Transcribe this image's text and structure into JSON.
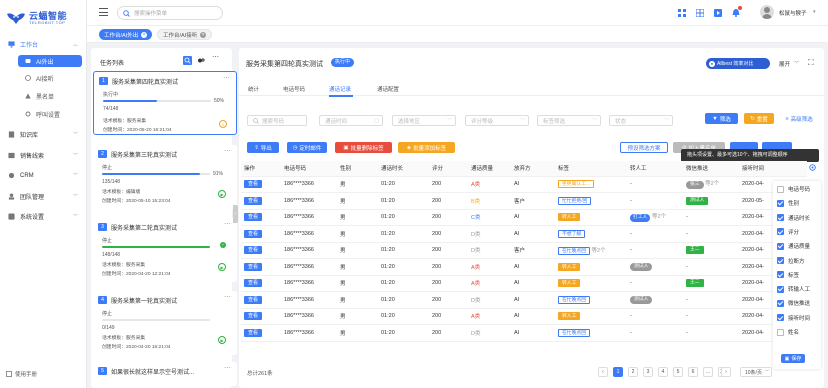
{
  "brand": {
    "name": "云蝠智能",
    "sub": "TELROBOT.TOP"
  },
  "sidebar": {
    "items": [
      {
        "label": "工作台",
        "icon": "monitor-icon"
      },
      {
        "label": "AI外出"
      },
      {
        "label": "AI接听"
      },
      {
        "label": "黑名单"
      },
      {
        "label": "呼叫设置"
      },
      {
        "label": "知识库"
      },
      {
        "label": "销售线索"
      },
      {
        "label": "CRM"
      },
      {
        "label": "团队管理"
      },
      {
        "label": "系统设置"
      }
    ],
    "manual": "使用手册"
  },
  "header": {
    "search_placeholder": "搜索操作菜单",
    "user": "松鼠与猴子"
  },
  "tabs": [
    {
      "label": "工作台/AI外出"
    },
    {
      "label": "工作台/AI接听"
    }
  ],
  "tasks": {
    "title": "任务列表",
    "items": [
      {
        "num": "1",
        "title": "服务采集第四轮真实测试",
        "status": "执行中",
        "progress": 50,
        "pct": "50%",
        "count": "74/148",
        "template": "话术模板：服务采集",
        "created": "创建时间：2020-05-20 16:21:04"
      },
      {
        "num": "2",
        "title": "服务采集第三轮真实测试",
        "status": "停止",
        "progress": 91,
        "pct": "91%",
        "count": "135/148",
        "template": "话术模板：编辑版",
        "created": "创建时间：2020-05-10 15:23:04"
      },
      {
        "num": "3",
        "title": "服务采集第二轮真实测试",
        "status": "停止",
        "progress": 100,
        "pct": "",
        "count": "148/148",
        "template": "话术模板：服务采集",
        "created": "创建时间：2020-04-20 12:21:04"
      },
      {
        "num": "4",
        "title": "服务采集第一轮真实测试",
        "status": "停止",
        "progress": 0,
        "pct": "",
        "count": "0/149",
        "template": "话术模板：服务采集",
        "created": "创建时间：2020-04-20 16:21:04"
      },
      {
        "num": "5",
        "title": "如果很长就这样显示空号测试..."
      }
    ]
  },
  "main": {
    "title": "服务采集第四轮真实测试",
    "status_badge": "执行中",
    "promo": "Allbest 效率对比",
    "expand": "展开",
    "subtabs": [
      "统计",
      "电话号码",
      "通话记录",
      "通话配置"
    ],
    "filters": [
      "搜索号码",
      "通话时间",
      "选择地区",
      "评分等级",
      "标签筛选",
      "意向",
      "状态"
    ],
    "filter_btn": "筛选",
    "reset_btn": "重置",
    "adv_btn": "高级筛选",
    "actions": [
      "导出",
      "定时邮件",
      "批量删除标签",
      "批量添加标签"
    ],
    "right_actions": [
      "预设筛选方案",
      "加入黑名单"
    ],
    "tooltip": "拖头项设置、最多可选10个、拖拽可调整顺序",
    "columns": [
      "操作",
      "电话号码",
      "性别",
      "通话时长",
      "评分",
      "通话质量",
      "放弃方",
      "标签",
      "转人工",
      "微信推送",
      "接听时间"
    ],
    "rows": [
      {
        "op": "查看",
        "phone": "186****3366",
        "sex": "男",
        "dur": "01:20",
        "score": "200",
        "q": "A类",
        "qc": "#e74c3c",
        "who": "AI",
        "tag": "拒绝确认工...",
        "tagc": "#f5a623",
        "tagbg": "#fff",
        "tagborder": "#f5a623",
        "agent": "-",
        "wx": "张三",
        "wxmore": "等2个",
        "wxtype": "grey",
        "time": "2020-04-"
      },
      {
        "op": "查看",
        "phone": "186****3366",
        "sex": "男",
        "dur": "01:20",
        "score": "200",
        "q": "B类",
        "qc": "#f5a623",
        "who": "客户",
        "tag": "忙忙拒绝/回",
        "tagc": "#3e7cf7",
        "tagbg": "#fff",
        "tagborder": "#3e7cf7",
        "agent": "-",
        "wx": "测试人",
        "wxmore": "",
        "wxtype": "green",
        "time": "2020-05-"
      },
      {
        "op": "查看",
        "phone": "186****3366",
        "sex": "男",
        "dur": "01:20",
        "score": "200",
        "q": "C类",
        "qc": "#3e7cf7",
        "who": "AI",
        "tag": "转人工",
        "tagc": "#fff",
        "tagbg": "#f5a623",
        "tagborder": "#f5a623",
        "agent": "打工人",
        "agentmore": "等2个",
        "wx": "-",
        "wxmore": "",
        "wxtype": "none",
        "time": "2020-04-"
      },
      {
        "op": "查看",
        "phone": "186****3366",
        "sex": "男",
        "dur": "01:20",
        "score": "200",
        "q": "D类",
        "qc": "#999",
        "who": "AI",
        "tag": "不想了解",
        "tagc": "#3e7cf7",
        "tagbg": "#fff",
        "tagborder": "#3e7cf7",
        "agent": "-",
        "wx": "-",
        "wxmore": "",
        "wxtype": "none",
        "time": "2020-04-"
      },
      {
        "op": "查看",
        "phone": "186****3366",
        "sex": "男",
        "dur": "01:20",
        "score": "200",
        "q": "D类",
        "qc": "#999",
        "who": "客户",
        "tag": "在忙晚点回",
        "tagc": "#3e7cf7",
        "tagbg": "#fff",
        "tagborder": "#3e7cf7",
        "tagmore": "等2个",
        "agent": "-",
        "wx": "王二",
        "wxmore": "",
        "wxtype": "green",
        "time": "2020-04-"
      },
      {
        "op": "查看",
        "phone": "186****3366",
        "sex": "男",
        "dur": "01:20",
        "score": "200",
        "q": "A类",
        "qc": "#e74c3c",
        "who": "AI",
        "tag": "转人工",
        "tagc": "#fff",
        "tagbg": "#f5a623",
        "tagborder": "#f5a623",
        "agent": "测试人",
        "agenttype": "grey",
        "wx": "-",
        "wxmore": "",
        "wxtype": "none",
        "time": "2020-04-"
      },
      {
        "op": "查看",
        "phone": "186****3366",
        "sex": "男",
        "dur": "01:20",
        "score": "200",
        "q": "A类",
        "qc": "#e74c3c",
        "who": "AI",
        "tag": "转人工",
        "tagc": "#fff",
        "tagbg": "#f5a623",
        "tagborder": "#f5a623",
        "agent": "-",
        "wx": "王二",
        "wxmore": "",
        "wxtype": "green",
        "time": "2020-04-"
      },
      {
        "op": "查看",
        "phone": "186****3366",
        "sex": "男",
        "dur": "01:20",
        "score": "200",
        "q": "D类",
        "qc": "#999",
        "who": "AI",
        "tag": "在忙晚点回",
        "tagc": "#3e7cf7",
        "tagbg": "#fff",
        "tagborder": "#3e7cf7",
        "agent": "测试人",
        "agenttype": "grey",
        "wx": "-",
        "wxmore": "",
        "wxtype": "none",
        "time": "2020-04-"
      },
      {
        "op": "查看",
        "phone": "186****3366",
        "sex": "男",
        "dur": "01:20",
        "score": "200",
        "q": "A类",
        "qc": "#e74c3c",
        "who": "AI",
        "tag": "转人工",
        "tagc": "#fff",
        "tagbg": "#f5a623",
        "tagborder": "#f5a623",
        "agent": "-",
        "wx": "-",
        "wxmore": "",
        "wxtype": "none",
        "time": "2020-04-"
      },
      {
        "op": "查看",
        "phone": "186****3366",
        "sex": "男",
        "dur": "01:20",
        "score": "200",
        "q": "D类",
        "qc": "#999",
        "who": "AI",
        "tag": "在忙晚点回",
        "tagc": "#3e7cf7",
        "tagbg": "#fff",
        "tagborder": "#3e7cf7",
        "agent": "-",
        "wx": "-",
        "wxmore": "",
        "wxtype": "none",
        "time": "2020-04-"
      }
    ],
    "col_settings": [
      {
        "label": "电话号码",
        "on": false
      },
      {
        "label": "性别",
        "on": true
      },
      {
        "label": "通话时长",
        "on": true
      },
      {
        "label": "评分",
        "on": true
      },
      {
        "label": "通话质量",
        "on": true
      },
      {
        "label": "拉断方",
        "on": true
      },
      {
        "label": "标签",
        "on": true
      },
      {
        "label": "转输人工",
        "on": true
      },
      {
        "label": "微信推送",
        "on": true
      },
      {
        "label": "接听时间",
        "on": true
      },
      {
        "label": "姓名",
        "on": false
      }
    ],
    "save_btn": "保存",
    "total": "总计261条",
    "pages": [
      "1",
      "2",
      "3",
      "4",
      "5",
      "6",
      "...",
      "27"
    ],
    "page_size": "10条/页"
  }
}
